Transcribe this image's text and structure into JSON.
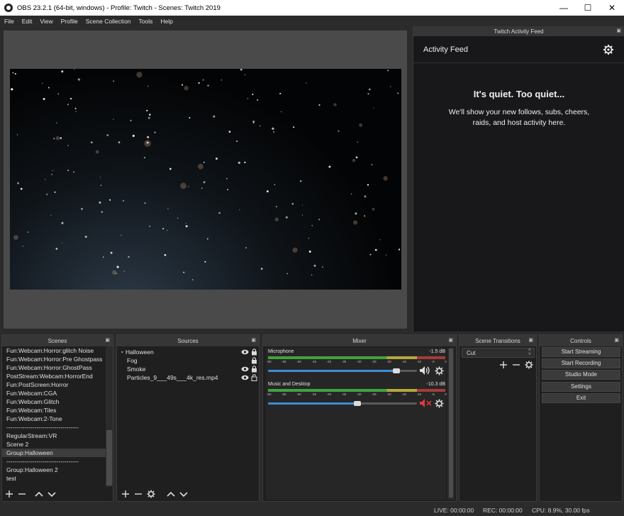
{
  "window": {
    "title": "OBS 23.2.1 (64-bit, windows) - Profile: Twitch - Scenes: Twitch 2019",
    "minimize": "—",
    "maximize": "☐",
    "close": "✕"
  },
  "menu": [
    "File",
    "Edit",
    "View",
    "Profile",
    "Scene Collection",
    "Tools",
    "Help"
  ],
  "twitch": {
    "dock_title": "Twitch Activity Feed",
    "feed_title": "Activity Feed",
    "quiet_heading": "It's quiet. Too quiet...",
    "quiet_body": "We'll show your new follows, subs, cheers, raids, and host activity here."
  },
  "scenes": {
    "title": "Scenes",
    "items": [
      "Fun:Webcam:Horror:glitch Noise",
      "Fun:Webcam:Horror:Pre Ghostpass",
      "Fun:Webcam:Horror:GhostPass",
      "PostStream:Webcam:HorrorEnd",
      "Fun:PostScreen:Horror",
      "Fun:Webcam:CGA",
      "Fun:Webcam:Glitch",
      "Fun:Webcam:Tiles",
      "Fun:Webcam:2-Tone",
      "------------------------------------",
      "RegularStream:VR",
      "Scene 2",
      "Group:Halloween",
      "------------------------------------",
      "Group:Halloween 2",
      "test"
    ],
    "selected_index": 12
  },
  "sources": {
    "title": "Sources",
    "group": "Halloween",
    "items": [
      "Fog",
      "Smoke",
      "Particles_9___49s___4k_res.mp4"
    ]
  },
  "mixer": {
    "title": "Mixer",
    "tick_labels": [
      "-60",
      "-55",
      "-50",
      "-45",
      "-40",
      "-35",
      "-30",
      "-25",
      "-20",
      "-15",
      "-10",
      "-5",
      "0"
    ],
    "channels": [
      {
        "name": "Microphone",
        "db": "-1.5 dB",
        "volume": 0.86,
        "muted": false
      },
      {
        "name": "Music and Desktop",
        "db": "-10.3 dB",
        "volume": 0.6,
        "muted": true
      }
    ]
  },
  "transitions": {
    "title": "Scene Transitions",
    "selected": "Cut"
  },
  "controls": {
    "title": "Controls",
    "buttons": [
      "Start Streaming",
      "Start Recording",
      "Studio Mode",
      "Settings",
      "Exit"
    ]
  },
  "status": {
    "live": "LIVE: 00:00:00",
    "rec": "REC: 00:00:00",
    "cpu": "CPU: 8.9%, 30.00 fps"
  },
  "colors": {
    "meter_green": "#3fa33f",
    "meter_yellow": "#b4a83a",
    "meter_red": "#a63a3a",
    "slider_blue": "#3c8ed8",
    "mute_red": "#e03a3a"
  }
}
